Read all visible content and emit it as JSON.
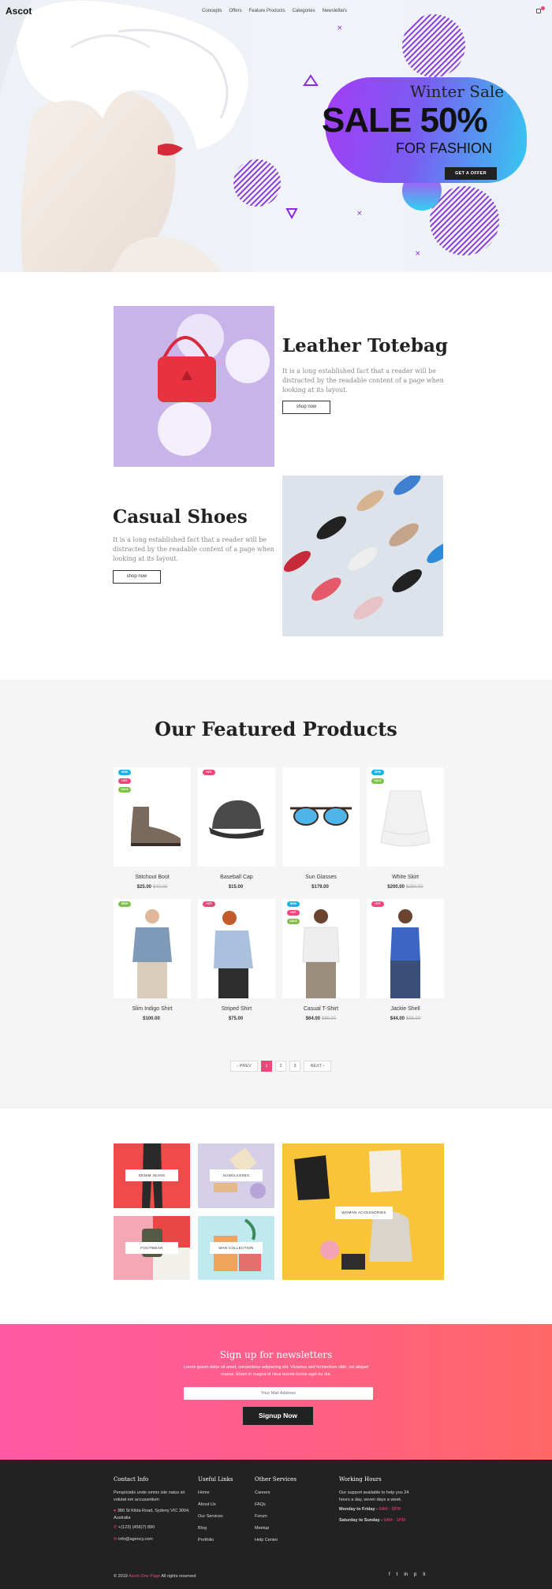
{
  "nav": {
    "logo": "Ascot",
    "menu": [
      "Concepts",
      "Offers",
      "Feature Products",
      "Categories",
      "Newsletters"
    ]
  },
  "hero": {
    "winter": "Winter Sale",
    "sale": "SALE 50%",
    "subtitle": "FOR FASHION",
    "button": "GET A OFFER"
  },
  "promos": [
    {
      "title": "Leather Totebag",
      "text": "It is a long established fact that a reader will be distracted by the readable content of a page when looking at its layout.",
      "button": "shop now"
    },
    {
      "title": "Casual Shoes",
      "text": "It is a long established fact that a reader will be distracted by the readable content of a page when looking at its layout.",
      "button": "shop now"
    }
  ],
  "featured": {
    "title": "Our Featured Products",
    "products": [
      {
        "name": "Stitchout Boot",
        "price": "$25.00",
        "old": "$40.00",
        "badges": [
          "NEW",
          "HOT",
          "SALE"
        ]
      },
      {
        "name": "Baseball Cap",
        "price": "$15.00",
        "old": "",
        "badges": [
          "HOT"
        ]
      },
      {
        "name": "Sun Glasses",
        "price": "$179.00",
        "old": "",
        "badges": []
      },
      {
        "name": "White Skirt",
        "price": "$200.00",
        "old": "$250.00",
        "badges": [
          "NEW",
          "SALE"
        ]
      },
      {
        "name": "Slim Indigo Shirt",
        "price": "$100.00",
        "old": "",
        "badges": [
          "NEW"
        ]
      },
      {
        "name": "Striped Shirt",
        "price": "$75.00",
        "old": "",
        "badges": [
          "HOT"
        ]
      },
      {
        "name": "Casual T-Shirt",
        "price": "$64.00",
        "old": "$80.00",
        "badges": [
          "NEW",
          "HOT",
          "SALE"
        ]
      },
      {
        "name": "Jackie Shell",
        "price": "$44.00",
        "old": "$55.00",
        "badges": [
          "HOT"
        ]
      }
    ],
    "pager": {
      "prev": "PREV",
      "pages": [
        "1",
        "2",
        "3"
      ],
      "next": "NEXT"
    }
  },
  "categories": [
    "DENIM JEANS",
    "SUNGLASSES",
    "WOMAN ACCESSORIES",
    "FOOTWEAR",
    "MAN COLLECTION"
  ],
  "newsletter": {
    "title": "Sign up for newsletters",
    "text": "Lorem ipsum dolor sit amet, consectetur adipiscing elit. Vivamus sed fermentum nibh, vel aliquet massa. Etiam in magna id risus lacinia luctus eget eu dui.",
    "placeholder": "Your Mail Address",
    "button": "Signup Now"
  },
  "footer": {
    "contact": {
      "title": "Contact Info",
      "text": "Perspiciatis unde omnis iste natus sit volutat em accusantium",
      "address": "380 St Kilda Road, Sydeny VIC 3004, Australia",
      "phone": "+(123) (456)7) 890",
      "email": "info@agency.com"
    },
    "useful": {
      "title": "Useful Links",
      "links": [
        "Home",
        "About Us",
        "Our Services",
        "Blog",
        "Portfolio"
      ]
    },
    "other": {
      "title": "Other Services",
      "links": [
        "Careers",
        "FAQs",
        "Forum",
        "Meetup",
        "Help Center"
      ]
    },
    "hours": {
      "title": "Working Hours",
      "text": "Our support available to help you 24 hours a day, seven days a week.",
      "weekday_label": "Monday to Friday -",
      "weekday_time": "9AM - 5PM",
      "weekend_label": "Saturday to Sunday -",
      "weekend_time": "9AM - 1PM"
    },
    "copyright_pre": "© 2019",
    "copyright_brand": "Ascot One Page",
    "copyright_post": "All rights reserved",
    "social": [
      "f",
      "t",
      "in",
      "p",
      "li"
    ]
  },
  "colors": {
    "accent": "#f0457a",
    "dark": "#222222"
  }
}
